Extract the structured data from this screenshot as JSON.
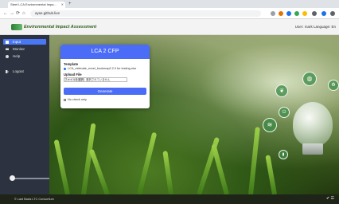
{
  "browser": {
    "tab_title": "Steel LCA Environmental Impa...",
    "tab_close": "✕",
    "tab_new": "+",
    "nav": {
      "back": "←",
      "forward": "→",
      "reload": "⟳",
      "home": "⌂"
    },
    "url": "ayse.github.live"
  },
  "app": {
    "title": "Environmental Impact Assessment",
    "header_right": "User: mark Language: En"
  },
  "sidebar": {
    "items": [
      {
        "label": "Input",
        "icon": "input-icon",
        "active": true
      },
      {
        "label": "Monitor",
        "icon": "monitor-icon",
        "active": false
      },
      {
        "label": "Help",
        "icon": "help-icon",
        "active": false
      },
      {
        "label": "Logout",
        "icon": "logout-icon",
        "active": false
      }
    ]
  },
  "card": {
    "title": "LCA 2 CFP",
    "template_label": "Template",
    "template_option": "LCA_estimate_excel_bookmap2.2.0 for testing.xlsx",
    "upload_label": "Upload File",
    "file_button": "ファイルを選択",
    "file_name": "選択されていません",
    "generate_button": "Generate",
    "check_label": "No check only"
  },
  "status": {
    "left": "© Last Basis LTC Consortium",
    "right": "✔ ☰"
  },
  "colors": {
    "accent": "#4a6cf7",
    "sidebar": "#2c3240",
    "brand": "#2e5d1e"
  }
}
